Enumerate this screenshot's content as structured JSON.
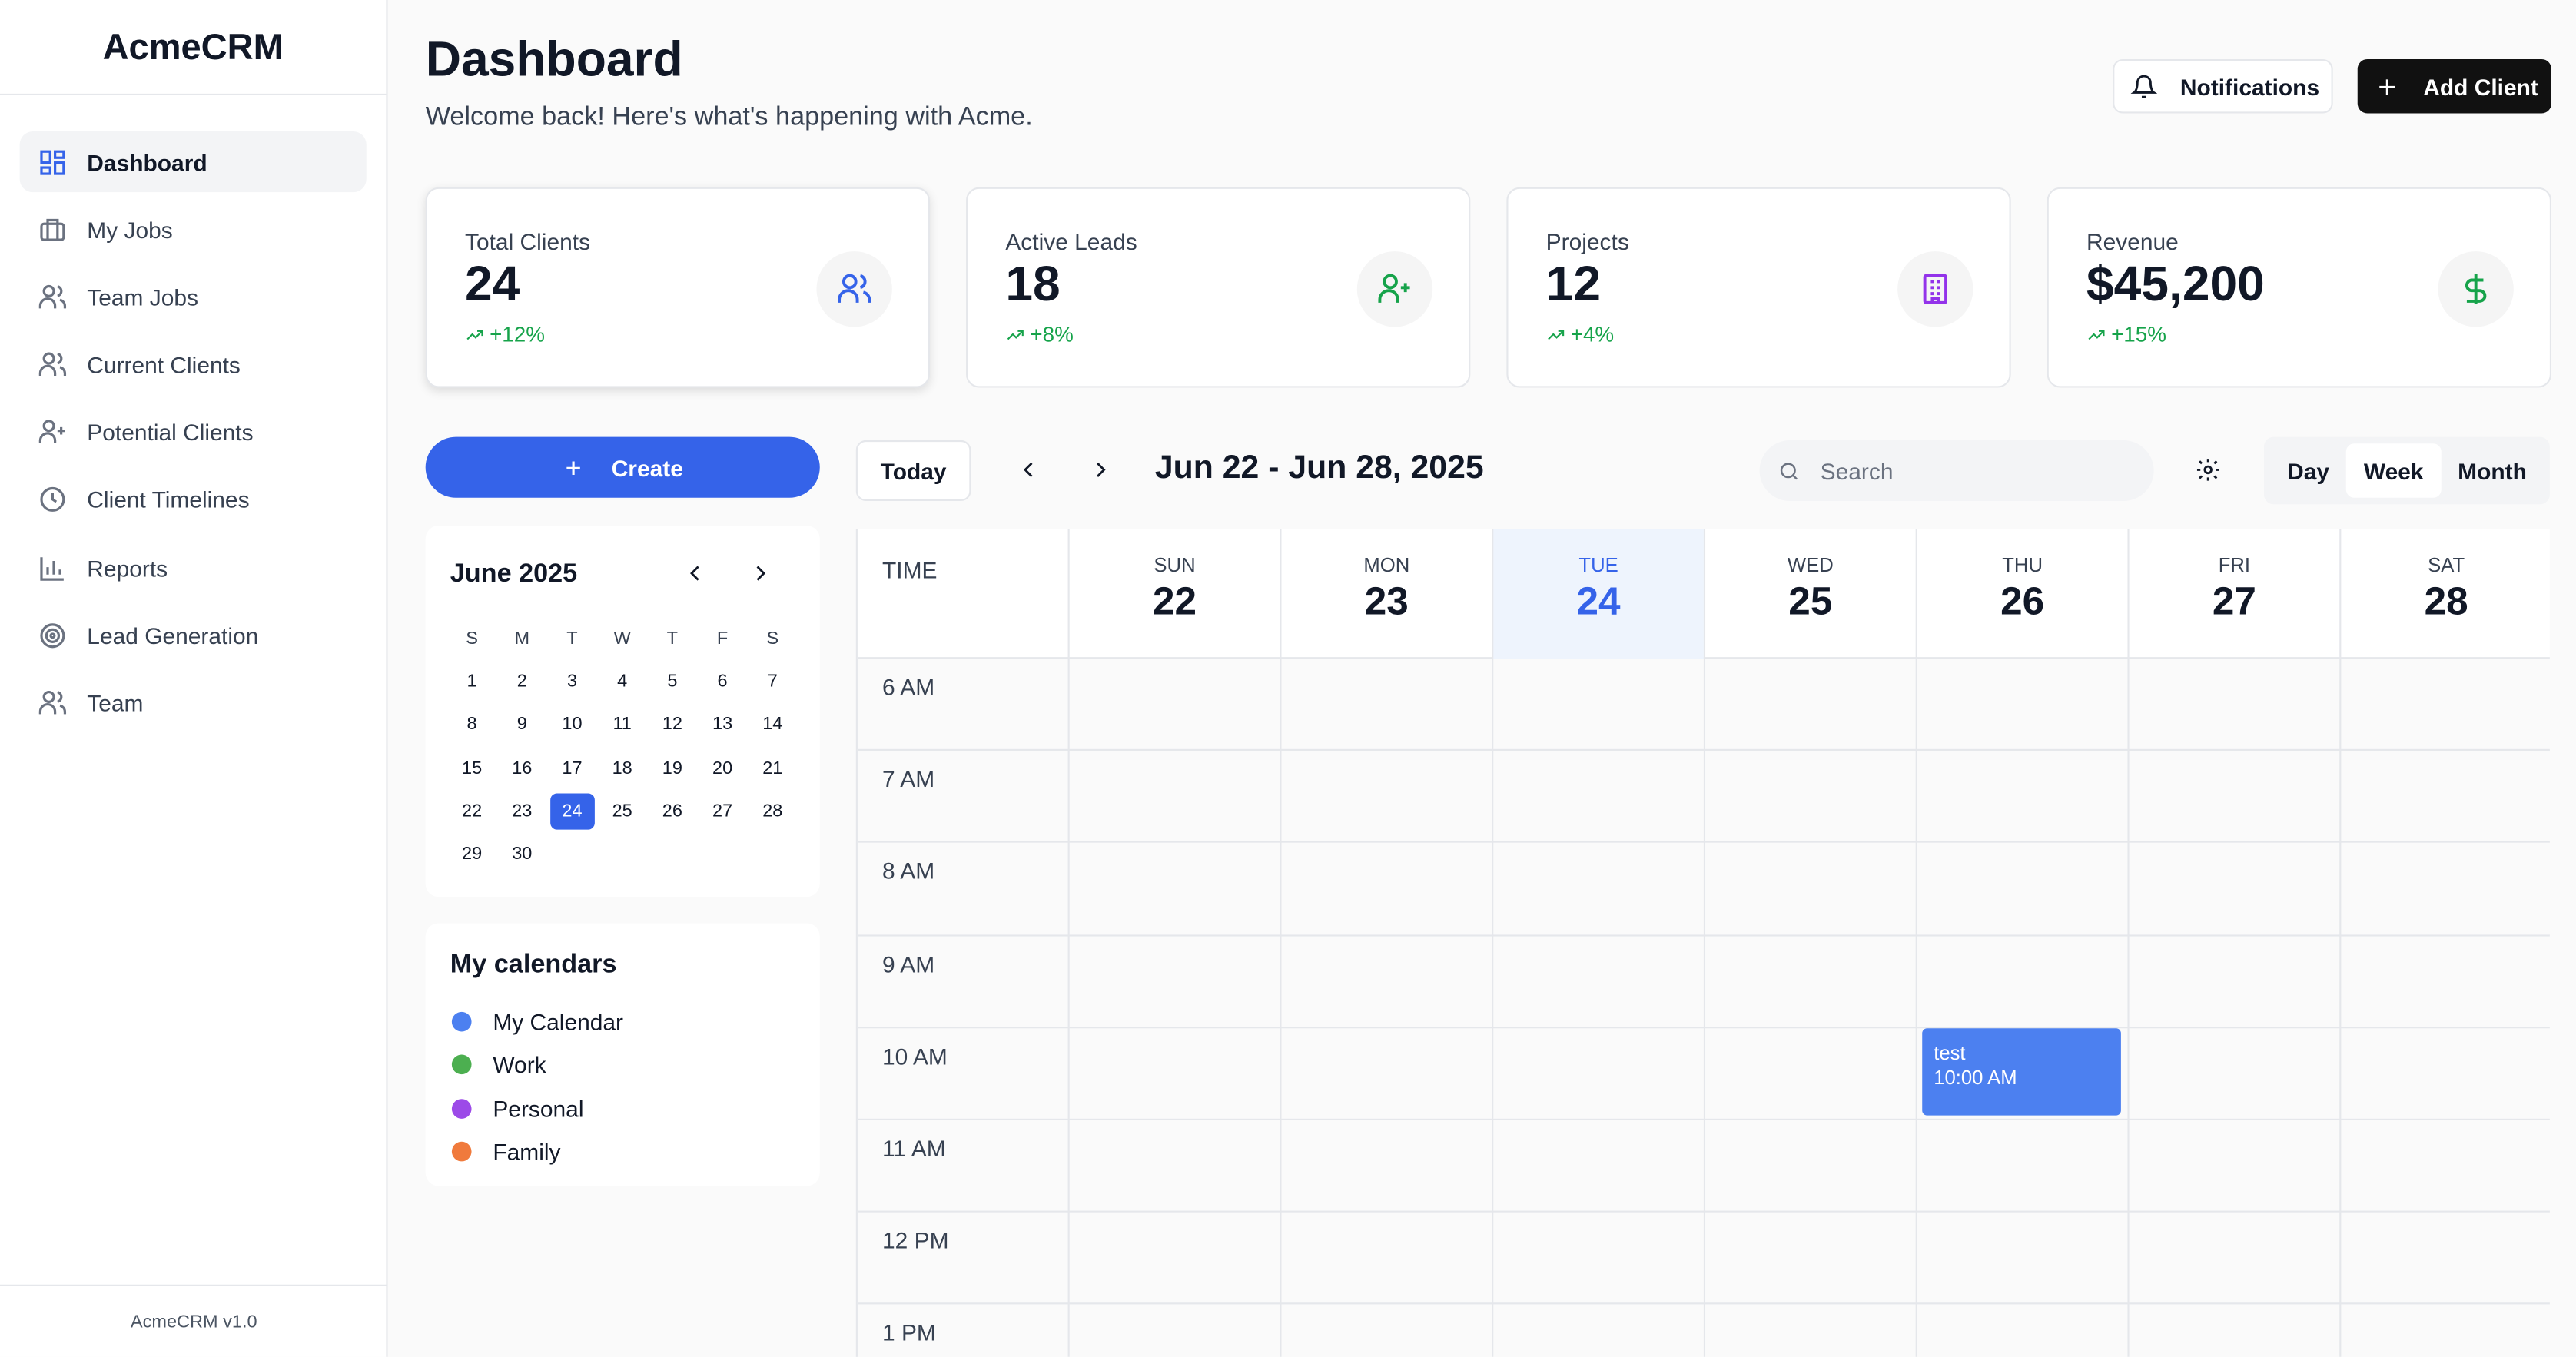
{
  "app": {
    "name": "AcmeCRM",
    "version": "AcmeCRM v1.0"
  },
  "sidebar": {
    "items": [
      {
        "label": "Dashboard",
        "icon": "dashboard-icon",
        "active": true
      },
      {
        "label": "My Jobs",
        "icon": "briefcase-icon"
      },
      {
        "label": "Team Jobs",
        "icon": "users-icon"
      },
      {
        "label": "Current Clients",
        "icon": "users-icon"
      },
      {
        "label": "Potential Clients",
        "icon": "user-plus-icon"
      },
      {
        "label": "Client Timelines",
        "icon": "clock-icon"
      },
      {
        "label": "Reports",
        "icon": "bar-chart-icon"
      },
      {
        "label": "Lead Generation",
        "icon": "target-icon"
      },
      {
        "label": "Team",
        "icon": "users-icon"
      }
    ]
  },
  "header": {
    "title": "Dashboard",
    "subtitle": "Welcome back! Here's what's happening with Acme.",
    "notifications_label": "Notifications",
    "add_client_label": "Add Client"
  },
  "stats": [
    {
      "label": "Total Clients",
      "value": "24",
      "change": "+12%",
      "icon": "users-icon",
      "icon_color": "#3563e9"
    },
    {
      "label": "Active Leads",
      "value": "18",
      "change": "+8%",
      "icon": "user-plus-icon",
      "icon_color": "#16a34a"
    },
    {
      "label": "Projects",
      "value": "12",
      "change": "+4%",
      "icon": "building-icon",
      "icon_color": "#9333ea"
    },
    {
      "label": "Revenue",
      "value": "$45,200",
      "change": "+15%",
      "icon": "dollar-icon",
      "icon_color": "#16a34a"
    }
  ],
  "create_label": "Create",
  "mini_calendar": {
    "title": "June 2025",
    "weekdays": [
      "S",
      "M",
      "T",
      "W",
      "T",
      "F",
      "S"
    ],
    "weeks": [
      [
        "1",
        "2",
        "3",
        "4",
        "5",
        "6",
        "7"
      ],
      [
        "8",
        "9",
        "10",
        "11",
        "12",
        "13",
        "14"
      ],
      [
        "15",
        "16",
        "17",
        "18",
        "19",
        "20",
        "21"
      ],
      [
        "22",
        "23",
        "24",
        "25",
        "26",
        "27",
        "28"
      ],
      [
        "29",
        "30",
        "",
        "",
        "",
        "",
        ""
      ]
    ],
    "selected": "24"
  },
  "my_calendars": {
    "title": "My calendars",
    "items": [
      {
        "label": "My Calendar",
        "color": "#4c80f0"
      },
      {
        "label": "Work",
        "color": "#4caf50"
      },
      {
        "label": "Personal",
        "color": "#9c4ae8"
      },
      {
        "label": "Family",
        "color": "#f07a3c"
      }
    ]
  },
  "calendar": {
    "today_label": "Today",
    "range": "Jun 22 - Jun 28, 2025",
    "search_placeholder": "Search",
    "views": {
      "day": "Day",
      "week": "Week",
      "month": "Month",
      "selected": "Week"
    },
    "time_header": "TIME",
    "days": [
      {
        "name": "SUN",
        "date": "22"
      },
      {
        "name": "MON",
        "date": "23"
      },
      {
        "name": "TUE",
        "date": "24",
        "today": true
      },
      {
        "name": "WED",
        "date": "25"
      },
      {
        "name": "THU",
        "date": "26"
      },
      {
        "name": "FRI",
        "date": "27"
      },
      {
        "name": "SAT",
        "date": "28"
      }
    ],
    "hours": [
      "6 AM",
      "7 AM",
      "8 AM",
      "9 AM",
      "10 AM",
      "11 AM",
      "12 PM",
      "1 PM"
    ],
    "event": {
      "title": "test",
      "time": "10:00 AM",
      "day": "THU",
      "color": "#4c80f0"
    }
  }
}
